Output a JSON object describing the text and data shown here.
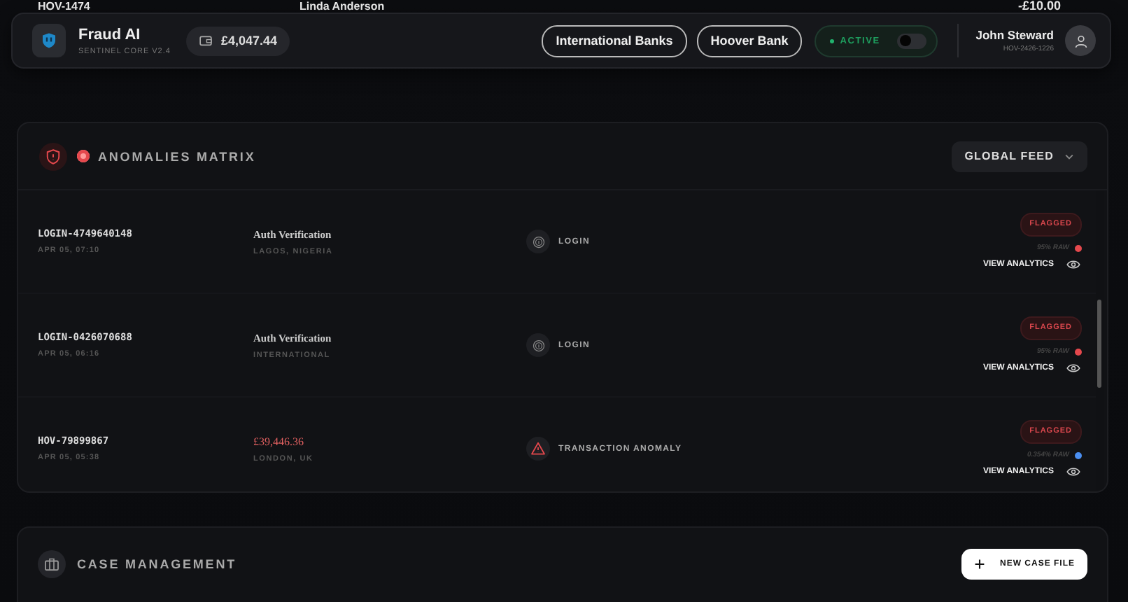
{
  "background_row": {
    "id": "HOV-1474",
    "name": "Linda Anderson",
    "amount": "-£10.00"
  },
  "header": {
    "title": "Fraud AI",
    "subtitle": "SENTINEL CORE V2.4",
    "balance": "£4,047.44",
    "banks": [
      {
        "label": "International Banks"
      },
      {
        "label": "Hoover Bank"
      }
    ],
    "status": {
      "label": "ACTIVE",
      "on": false
    },
    "user": {
      "name": "John Steward",
      "id": "HOV-2426-1226"
    }
  },
  "anomalies": {
    "title": "ANOMALIES MATRIX",
    "filter": "GLOBAL FEED",
    "rows": [
      {
        "id": "LOGIN-4749640148",
        "time": "APR 05, 07:10",
        "detail": {
          "kind": "text",
          "text": "Auth Verification"
        },
        "location": "LAGOS, NIGERIA",
        "type": {
          "kind": "login",
          "label": "LOGIN"
        },
        "status": "FLAGGED",
        "risk": "95% RAW",
        "color": "#e5484d",
        "action": "VIEW ANALYTICS"
      },
      {
        "id": "LOGIN-0426070688",
        "time": "APR 05, 06:16",
        "detail": {
          "kind": "text",
          "text": "Auth Verification"
        },
        "location": "INTERNATIONAL",
        "type": {
          "kind": "login",
          "label": "LOGIN"
        },
        "status": "FLAGGED",
        "risk": "95% RAW",
        "color": "#e5484d",
        "action": "VIEW ANALYTICS"
      },
      {
        "id": "HOV-79899867",
        "time": "APR 05, 05:38",
        "detail": {
          "kind": "amount",
          "text": "£39,446.36"
        },
        "location": "LONDON, UK",
        "type": {
          "kind": "anomaly",
          "label": "TRANSACTION ANOMALY"
        },
        "status": "FLAGGED",
        "risk": "0.354% RAW",
        "color": "#4a8ef0",
        "action": "VIEW ANALYTICS"
      }
    ]
  },
  "cases": {
    "title": "CASE MANAGEMENT",
    "button": "NEW CASE FILE"
  }
}
